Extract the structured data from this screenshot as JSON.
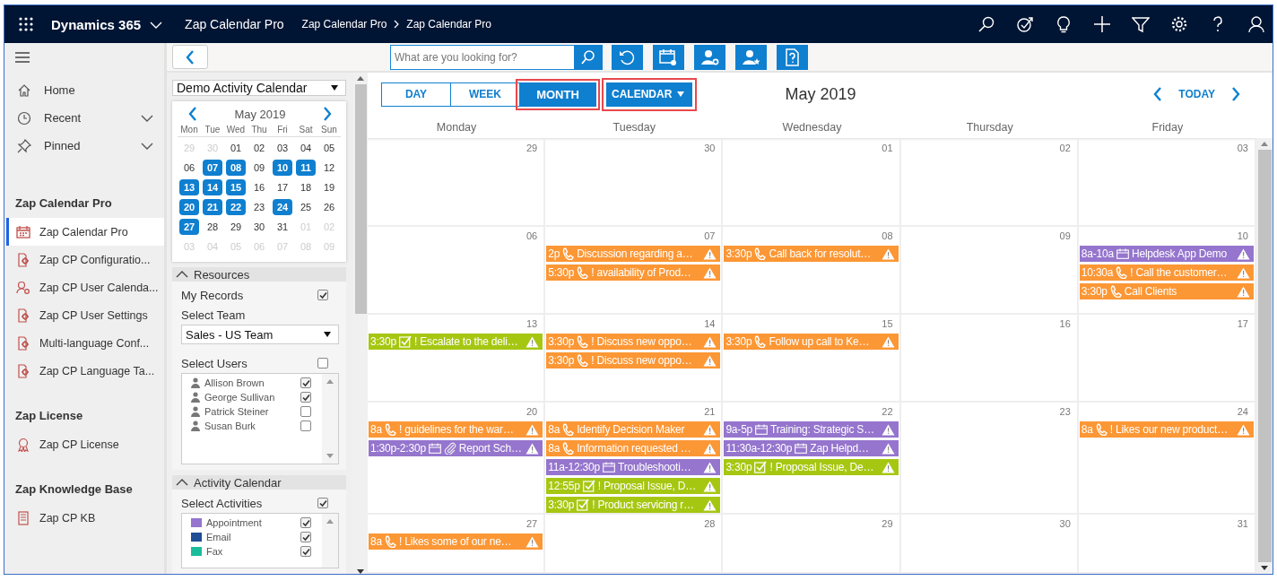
{
  "header": {
    "product": "Dynamics 365",
    "app_name": "Zap Calendar Pro",
    "breadcrumb": [
      "Zap Calendar Pro",
      "Zap Calendar Pro"
    ]
  },
  "nav": {
    "top_items": [
      {
        "label": "Home",
        "expandable": false
      },
      {
        "label": "Recent",
        "expandable": true
      },
      {
        "label": "Pinned",
        "expandable": true
      }
    ],
    "sections": [
      {
        "title": "Zap Calendar Pro",
        "items": [
          {
            "label": "Zap Calendar Pro",
            "selected": true
          },
          {
            "label": "Zap CP Configuratio...",
            "selected": false
          },
          {
            "label": "Zap CP User Calenda...",
            "selected": false
          },
          {
            "label": "Zap CP User Settings",
            "selected": false
          },
          {
            "label": "Multi-language Conf...",
            "selected": false
          },
          {
            "label": "Zap CP Language Ta...",
            "selected": false
          }
        ]
      },
      {
        "title": "Zap License",
        "items": [
          {
            "label": "Zap CP License",
            "selected": false
          }
        ]
      },
      {
        "title": "Zap Knowledge Base",
        "items": [
          {
            "label": "Zap CP KB",
            "selected": false
          }
        ]
      }
    ]
  },
  "toolbar": {
    "search": {
      "placeholder": "What are you looking for?"
    }
  },
  "side_panel": {
    "calendar_select": "Demo Activity Calendar",
    "mini_calendar": {
      "title": "May 2019",
      "weekdays": [
        "Mon",
        "Tue",
        "Wed",
        "Thu",
        "Fri",
        "Sat",
        "Sun"
      ],
      "weeks": [
        {
          "days": [
            {
              "label": "29",
              "muted": true,
              "marked": false
            },
            {
              "label": "30",
              "muted": true,
              "marked": false
            },
            {
              "label": "01",
              "muted": false,
              "marked": false
            },
            {
              "label": "02",
              "muted": false,
              "marked": false
            },
            {
              "label": "03",
              "muted": false,
              "marked": false
            },
            {
              "label": "04",
              "muted": false,
              "marked": false
            },
            {
              "label": "05",
              "muted": false,
              "marked": false
            }
          ]
        },
        {
          "days": [
            {
              "label": "06",
              "muted": false,
              "marked": false
            },
            {
              "label": "07",
              "muted": false,
              "marked": true
            },
            {
              "label": "08",
              "muted": false,
              "marked": true
            },
            {
              "label": "09",
              "muted": false,
              "marked": false
            },
            {
              "label": "10",
              "muted": false,
              "marked": true
            },
            {
              "label": "11",
              "muted": false,
              "marked": true
            },
            {
              "label": "12",
              "muted": false,
              "marked": false
            }
          ]
        },
        {
          "days": [
            {
              "label": "13",
              "muted": false,
              "marked": true
            },
            {
              "label": "14",
              "muted": false,
              "marked": true
            },
            {
              "label": "15",
              "muted": false,
              "marked": true
            },
            {
              "label": "16",
              "muted": false,
              "marked": false
            },
            {
              "label": "17",
              "muted": false,
              "marked": false
            },
            {
              "label": "18",
              "muted": false,
              "marked": false
            },
            {
              "label": "19",
              "muted": false,
              "marked": false
            }
          ]
        },
        {
          "days": [
            {
              "label": "20",
              "muted": false,
              "marked": true
            },
            {
              "label": "21",
              "muted": false,
              "marked": true
            },
            {
              "label": "22",
              "muted": false,
              "marked": true
            },
            {
              "label": "23",
              "muted": false,
              "marked": false
            },
            {
              "label": "24",
              "muted": false,
              "marked": true
            },
            {
              "label": "25",
              "muted": false,
              "marked": false
            },
            {
              "label": "26",
              "muted": false,
              "marked": false
            }
          ]
        },
        {
          "days": [
            {
              "label": "27",
              "muted": false,
              "marked": true
            },
            {
              "label": "28",
              "muted": false,
              "marked": false
            },
            {
              "label": "29",
              "muted": false,
              "marked": false
            },
            {
              "label": "30",
              "muted": false,
              "marked": false
            },
            {
              "label": "31",
              "muted": false,
              "marked": false
            },
            {
              "label": "01",
              "muted": true,
              "marked": false
            },
            {
              "label": "02",
              "muted": true,
              "marked": false
            }
          ]
        },
        {
          "days": [
            {
              "label": "03",
              "muted": true,
              "marked": false
            },
            {
              "label": "04",
              "muted": true,
              "marked": false
            },
            {
              "label": "05",
              "muted": true,
              "marked": false
            },
            {
              "label": "06",
              "muted": true,
              "marked": false
            },
            {
              "label": "07",
              "muted": true,
              "marked": false
            },
            {
              "label": "08",
              "muted": true,
              "marked": false
            },
            {
              "label": "09",
              "muted": true,
              "marked": false
            }
          ]
        }
      ]
    },
    "resources": {
      "title": "Resources",
      "expanded": true,
      "my_records": {
        "label": "My Records",
        "checked": true
      },
      "select_team": {
        "label": "Select Team",
        "value": "Sales - US Team"
      },
      "select_users": {
        "label": "Select Users",
        "checked": false,
        "users": [
          {
            "name": "Allison Brown",
            "checked": true
          },
          {
            "name": "George Sullivan",
            "checked": true
          },
          {
            "name": "Patrick Steiner",
            "checked": false
          },
          {
            "name": "Susan Burk",
            "checked": false
          }
        ]
      }
    },
    "activity_calendar": {
      "title": "Activity Calendar",
      "expanded": true,
      "select_activities": {
        "label": "Select Activities",
        "checked": true
      },
      "activities": [
        {
          "name": "Appointment",
          "color": "#9575cd",
          "checked": true
        },
        {
          "name": "Email",
          "color": "#1f4e96",
          "checked": true
        },
        {
          "name": "Fax",
          "color": "#1abc9c",
          "checked": true
        }
      ]
    }
  },
  "calendar": {
    "views": [
      {
        "label": "DAY",
        "selected": false,
        "highlighted": false
      },
      {
        "label": "WEEK",
        "selected": false,
        "highlighted": false
      },
      {
        "label": "MONTH",
        "selected": true,
        "highlighted": true
      }
    ],
    "mode_button": {
      "label": "CALENDAR",
      "highlighted": true
    },
    "title": "May 2019",
    "today": "TODAY",
    "columns": [
      "Monday",
      "Tuesday",
      "Wednesday",
      "Thursday",
      "Friday"
    ],
    "weeks": [
      {
        "days": [
          {
            "date": "29"
          },
          {
            "date": "30"
          },
          {
            "date": "01"
          },
          {
            "date": "02"
          },
          {
            "date": "03"
          }
        ]
      },
      {
        "days": [
          {
            "date": "06"
          },
          {
            "date": "07",
            "events": [
              {
                "time": "2p",
                "kind": "phone",
                "text": "Discussion regarding a…",
                "color": "#fc9735",
                "attachment": false
              },
              {
                "time": "5:30p",
                "kind": "phone",
                "text": "! availability of Prod…",
                "color": "#fc9735",
                "attachment": false
              }
            ]
          },
          {
            "date": "08",
            "events": [
              {
                "time": "3:30p",
                "kind": "phone",
                "text": "Call back for resolut…",
                "color": "#fc9735",
                "attachment": false
              }
            ]
          },
          {
            "date": "09"
          },
          {
            "date": "10",
            "events": [
              {
                "time": "8a-10a",
                "kind": "appointment",
                "text": "Helpdesk App Demo",
                "color": "#9575cd",
                "attachment": false
              },
              {
                "time": "10:30a",
                "kind": "phone",
                "text": "! Call the customer…",
                "color": "#fc9735",
                "attachment": false
              },
              {
                "time": "3:30p",
                "kind": "phone",
                "text": "Call Clients",
                "color": "#fc9735",
                "attachment": false
              }
            ]
          }
        ]
      },
      {
        "days": [
          {
            "date": "13",
            "events": [
              {
                "time": "3:30p",
                "kind": "task",
                "text": "! Escalate to the deli…",
                "color": "#a6c712",
                "attachment": false
              }
            ]
          },
          {
            "date": "14",
            "events": [
              {
                "time": "3:30p",
                "kind": "phone",
                "text": "! Discuss new oppo…",
                "color": "#fc9735",
                "attachment": false
              },
              {
                "time": "3:30p",
                "kind": "phone",
                "text": "! Discuss new oppo…",
                "color": "#fc9735",
                "attachment": false
              }
            ]
          },
          {
            "date": "15",
            "events": [
              {
                "time": "3:30p",
                "kind": "phone",
                "text": "Follow up call to Ke…",
                "color": "#fc9735",
                "attachment": false
              }
            ]
          },
          {
            "date": "16"
          },
          {
            "date": "17"
          }
        ]
      },
      {
        "days": [
          {
            "date": "20",
            "events": [
              {
                "time": "8a",
                "kind": "phone",
                "text": "! guidelines for the war…",
                "color": "#fc9735",
                "attachment": false
              },
              {
                "time": "1:30p-2:30p",
                "kind": "appointment",
                "text": "Report Sch…",
                "color": "#9575cd",
                "attachment": true
              }
            ]
          },
          {
            "date": "21",
            "events": [
              {
                "time": "8a",
                "kind": "phone",
                "text": "Identify Decision Maker",
                "color": "#fc9735",
                "attachment": false
              },
              {
                "time": "8a",
                "kind": "phone",
                "text": "Information requested …",
                "color": "#fc9735",
                "attachment": false
              },
              {
                "time": "11a-12:30p",
                "kind": "appointment",
                "text": "Troubleshooti…",
                "color": "#9575cd",
                "attachment": false
              },
              {
                "time": "12:55p",
                "kind": "task",
                "text": "! Proposal Issue, D…",
                "color": "#a6c712",
                "attachment": false
              },
              {
                "time": "3:30p",
                "kind": "task",
                "text": "! Product servicing r…",
                "color": "#a6c712",
                "attachment": false
              }
            ]
          },
          {
            "date": "22",
            "events": [
              {
                "time": "9a-5p",
                "kind": "appointment",
                "text": "Training: Strategic S…",
                "color": "#9575cd",
                "attachment": false
              },
              {
                "time": "11:30a-12:30p",
                "kind": "appointment",
                "text": "Zap Helpd…",
                "color": "#9575cd",
                "attachment": false
              },
              {
                "time": "3:30p",
                "kind": "task",
                "text": "! Proposal Issue, De…",
                "color": "#a6c712",
                "attachment": false
              }
            ]
          },
          {
            "date": "23"
          },
          {
            "date": "24",
            "events": [
              {
                "time": "8a",
                "kind": "phone",
                "text": "! Likes our new product…",
                "color": "#fc9735",
                "attachment": false
              }
            ]
          }
        ]
      },
      {
        "days": [
          {
            "date": "27",
            "events": [
              {
                "time": "8a",
                "kind": "phone",
                "text": "! Likes some of our ne…",
                "color": "#fc9735",
                "attachment": false
              }
            ]
          },
          {
            "date": "28"
          },
          {
            "date": "29"
          },
          {
            "date": "30"
          },
          {
            "date": "31"
          }
        ]
      }
    ]
  }
}
